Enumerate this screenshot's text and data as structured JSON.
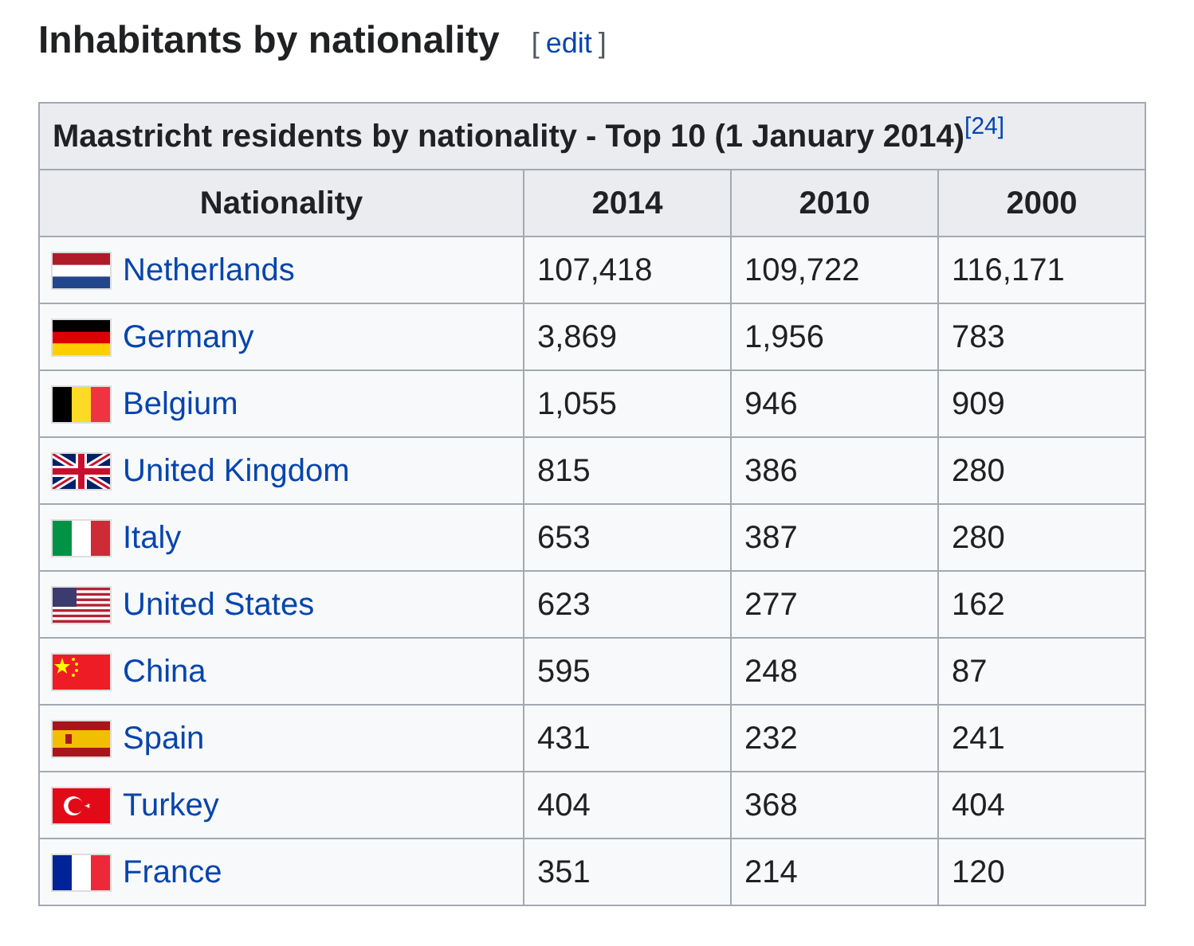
{
  "heading": {
    "title": "Inhabitants by nationality",
    "edit_open": "[",
    "edit_link": "edit",
    "edit_close": "]"
  },
  "table": {
    "caption": "Maastricht residents by nationality - Top 10 (1 January 2014)",
    "caption_ref": "[24]",
    "columns": [
      "Nationality",
      "2014",
      "2010",
      "2000"
    ],
    "rows": [
      {
        "country": "Netherlands",
        "values": [
          "107,418",
          "109,722",
          "116,171"
        ]
      },
      {
        "country": "Germany",
        "values": [
          "3,869",
          "1,956",
          "783"
        ]
      },
      {
        "country": "Belgium",
        "values": [
          "1,055",
          "946",
          "909"
        ]
      },
      {
        "country": "United Kingdom",
        "values": [
          "815",
          "386",
          "280"
        ]
      },
      {
        "country": "Italy",
        "values": [
          "653",
          "387",
          "280"
        ]
      },
      {
        "country": "United States",
        "values": [
          "623",
          "277",
          "162"
        ]
      },
      {
        "country": "China",
        "values": [
          "595",
          "248",
          "87"
        ]
      },
      {
        "country": "Spain",
        "values": [
          "431",
          "232",
          "241"
        ]
      },
      {
        "country": "Turkey",
        "values": [
          "404",
          "368",
          "404"
        ]
      },
      {
        "country": "France",
        "values": [
          "351",
          "214",
          "120"
        ]
      }
    ]
  }
}
